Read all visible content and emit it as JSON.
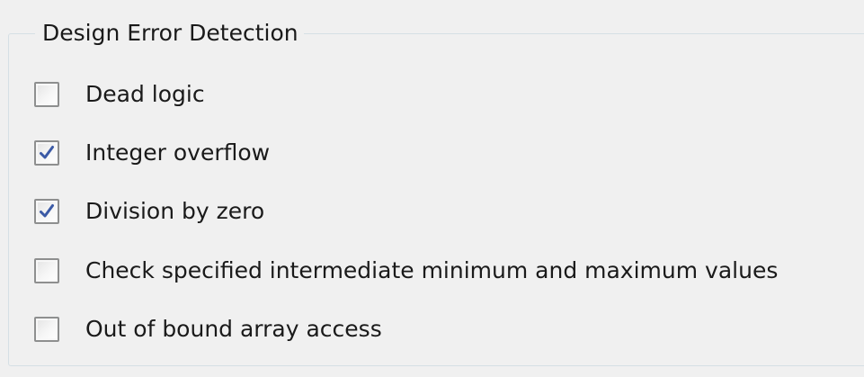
{
  "group": {
    "title": "Design Error Detection"
  },
  "options": [
    {
      "label": "Dead logic",
      "checked": false
    },
    {
      "label": "Integer overflow",
      "checked": true
    },
    {
      "label": "Division by zero",
      "checked": true
    },
    {
      "label": "Check specified intermediate minimum and maximum values",
      "checked": false
    },
    {
      "label": "Out of bound array access",
      "checked": false
    }
  ],
  "colors": {
    "checkmark": "#3b5aa6",
    "border": "#8e8f8f",
    "group_border": "#d5dfe5",
    "background": "#f0f0f0"
  }
}
